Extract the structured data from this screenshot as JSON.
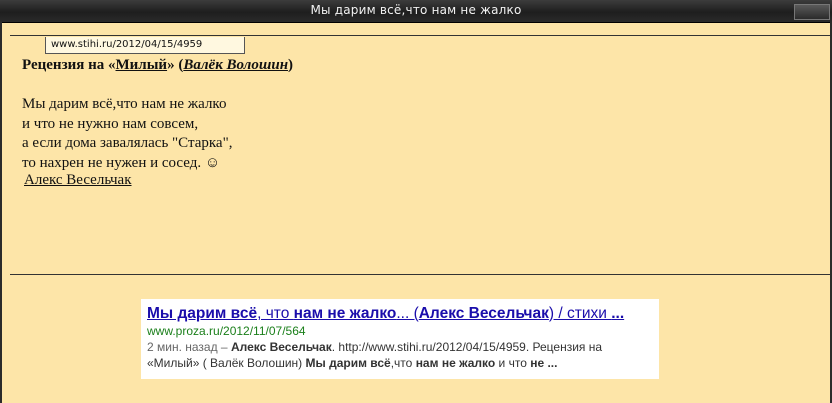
{
  "window": {
    "title": "Мы дарим всё,что нам не жалко"
  },
  "tooltip": {
    "url": "www.stihi.ru/2012/04/15/4959"
  },
  "review": {
    "prefix": "Рецензия на «",
    "work_title": "Милый",
    "middle": "» (",
    "author": "Валёк Волошин",
    "suffix": ")"
  },
  "poem": {
    "lines": [
      "Мы дарим всё,что нам не жалко",
      "и что не нужно нам совсем,",
      "а если дома завалялась \"Старка\",",
      "то нахрен не нужен и сосед. ☺"
    ],
    "signature": "Алекс Весельчак"
  },
  "search_result": {
    "title_parts": [
      {
        "text": "Мы дарим всё",
        "bold": true
      },
      {
        "text": ", что ",
        "bold": false
      },
      {
        "text": "нам не жалко",
        "bold": true
      },
      {
        "text": "... (",
        "bold": false
      },
      {
        "text": "Алекс Весельчак",
        "bold": true
      },
      {
        "text": ") / стихи ",
        "bold": false
      },
      {
        "text": "...",
        "bold": true
      }
    ],
    "url": "www.proza.ru/2012/11/07/564",
    "snippet_parts": [
      {
        "text": "2 мин. назад – ",
        "bold": false,
        "muted": true
      },
      {
        "text": "Алекс Весельчак",
        "bold": true
      },
      {
        "text": ". http://www.stihi.ru/2012/04/15/4959. Рецензия на «Милый» ( Валёк Волошин) ",
        "bold": false
      },
      {
        "text": "Мы дарим всё",
        "bold": true
      },
      {
        "text": ",что ",
        "bold": false
      },
      {
        "text": "нам не жалко",
        "bold": true
      },
      {
        "text": " и что ",
        "bold": false
      },
      {
        "text": "не ...",
        "bold": true
      }
    ]
  }
}
